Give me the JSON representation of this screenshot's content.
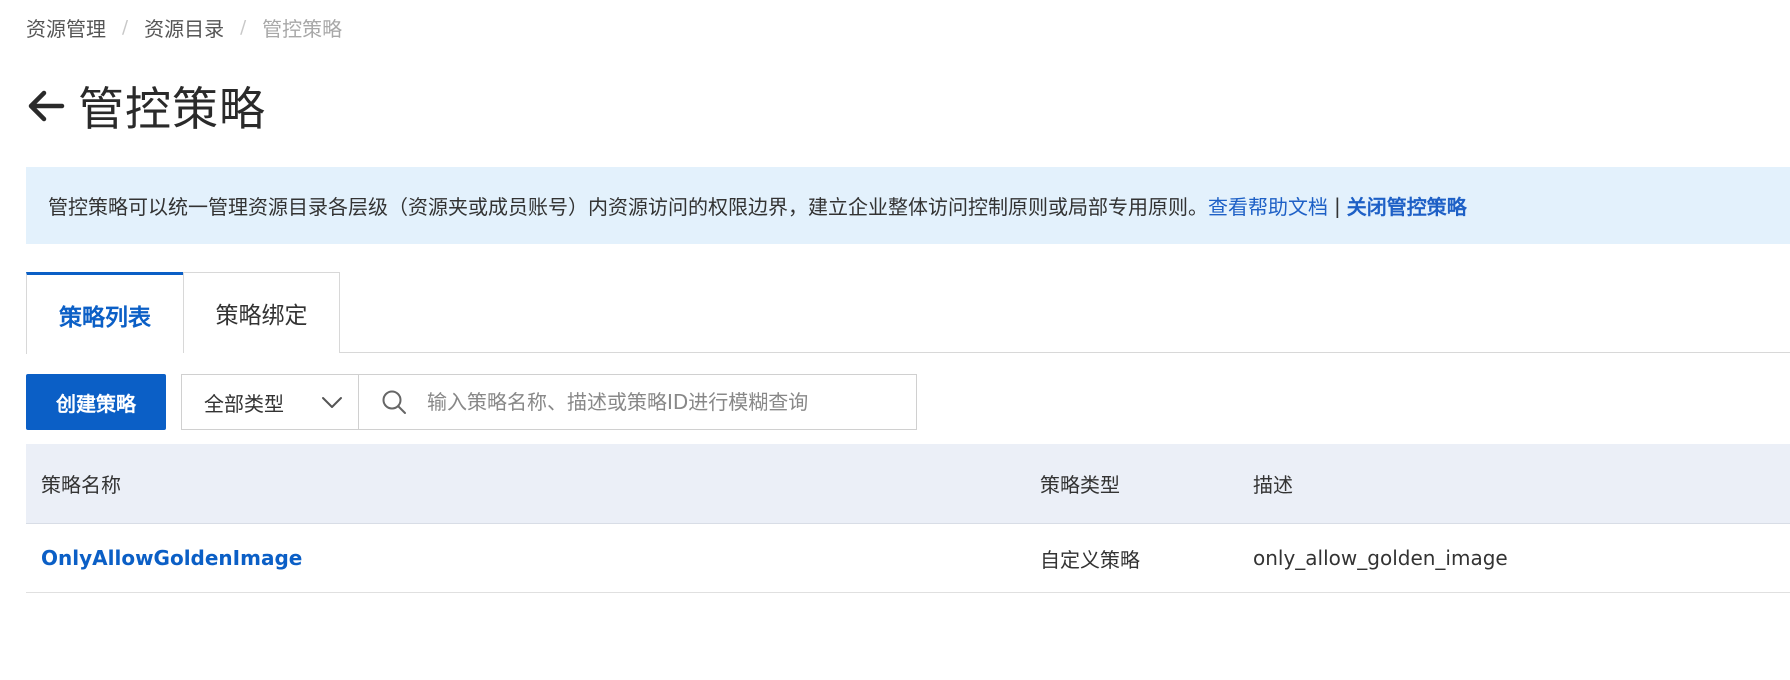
{
  "breadcrumb": {
    "items": [
      "资源管理",
      "资源目录",
      "管控策略"
    ],
    "separator": "/"
  },
  "page": {
    "title": "管控策略"
  },
  "banner": {
    "text": "管控策略可以统一管理资源目录各层级（资源夹或成员账号）内资源访问的权限边界，建立企业整体访问控制原则或局部专用原则。",
    "help_link": "查看帮助文档",
    "divider": "|",
    "disable_link": "关闭管控策略"
  },
  "tabs": [
    {
      "label": "策略列表",
      "active": true
    },
    {
      "label": "策略绑定",
      "active": false
    }
  ],
  "toolbar": {
    "create_label": "创建策略",
    "type_filter": "全部类型",
    "search_placeholder": "输入策略名称、描述或策略ID进行模糊查询",
    "search_value": ""
  },
  "table": {
    "columns": [
      "策略名称",
      "策略类型",
      "描述"
    ],
    "rows": [
      {
        "name": "OnlyAllowGoldenImage",
        "type": "自定义策略",
        "description": "only_allow_golden_image"
      }
    ]
  },
  "colors": {
    "primary": "#0b5fc6",
    "banner_bg": "#e3f1fc",
    "table_header_bg": "#ebeff7"
  },
  "icons": [
    "back-arrow-icon",
    "chevron-down-icon",
    "search-icon"
  ]
}
